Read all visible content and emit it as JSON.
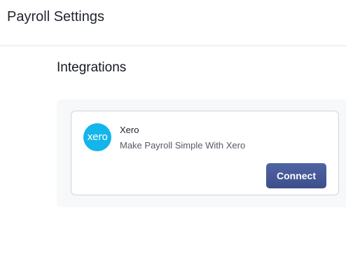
{
  "header": {
    "title": "Payroll Settings"
  },
  "section": {
    "title": "Integrations"
  },
  "integrations": [
    {
      "logo_text": "xero",
      "logo_color": "#13b5ea",
      "name": "Xero",
      "description": "Make Payroll Simple With Xero",
      "action_label": "Connect",
      "action_color": "#44579a"
    }
  ]
}
